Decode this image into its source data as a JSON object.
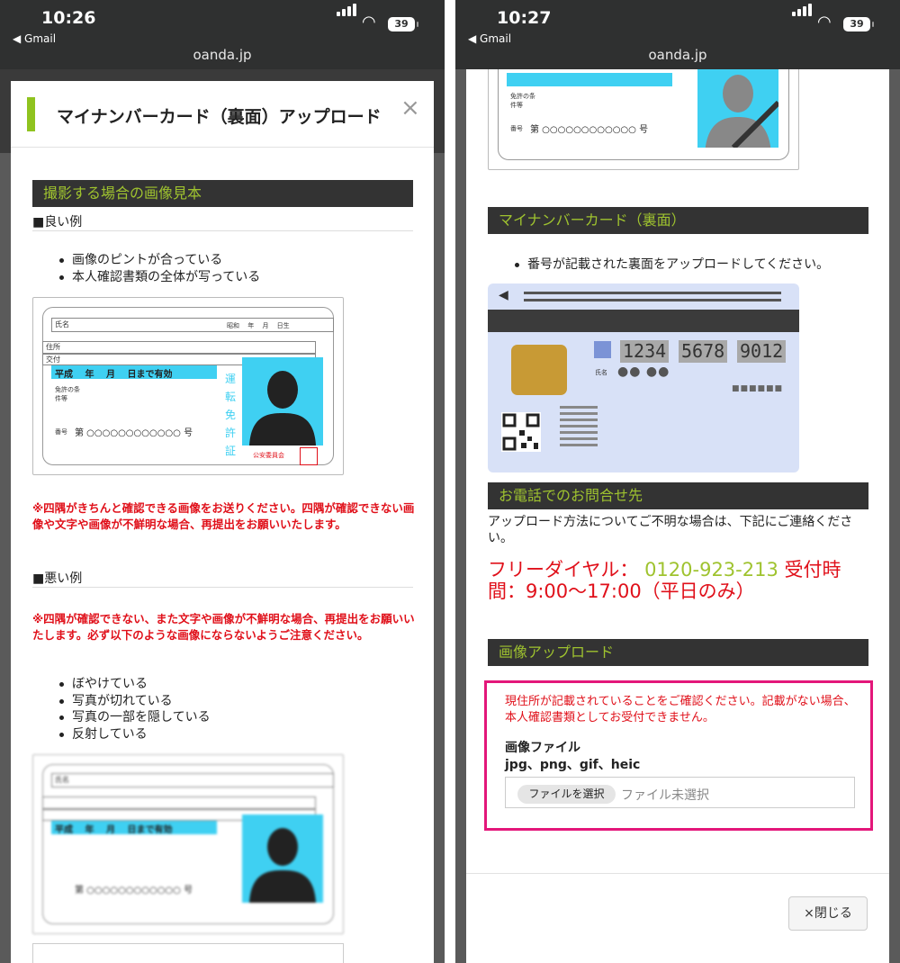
{
  "left": {
    "status": {
      "time": "10:26",
      "back_app": "◀ Gmail",
      "url": "oanda.jp",
      "battery": "39"
    },
    "modal": {
      "title": "マイナンバーカード（裏面）アップロード",
      "close_glyph": "×",
      "section_title": "撮影する場合の画像見本",
      "good_heading": "■良い例",
      "good_points": [
        "画像のピントが合っている",
        "本人確認書類の全体が写っている"
      ],
      "warning_1": "※四隅がきちんと確認できる画像をお送りください。四隅が確認できない画像や文字や画像が不鮮明な場合、再提出をお願いいたします。",
      "bad_heading": "■悪い例",
      "warning_2": "※四隅が確認できない、また文字や画像が不鮮明な場合、再提出をお願いいたします。必ず以下のような画像にならないようご注意ください。",
      "bad_points": [
        "ぼやけている",
        "写真が切れている",
        "写真の一部を隠している",
        "反射している"
      ]
    },
    "license": {
      "name_label": "氏名",
      "date_label": "昭和　 年　 月　 日生",
      "address_label": "住所",
      "issue_label": "交付",
      "valid_label": "平成　 年　 月　 日まで有効",
      "conditions_label": "免許の条件等",
      "number_label": "番号",
      "number_value": "第 ○○○○○○○○○○○○ 号",
      "vertical": [
        "運",
        "転",
        "免",
        "許",
        "証"
      ],
      "seal_text": "○○\n公安委員会",
      "seal_box": "公安委員会"
    }
  },
  "right": {
    "status": {
      "time": "10:27",
      "back_app": "◀ Gmail",
      "url": "oanda.jp",
      "battery": "39"
    },
    "modal": {
      "card_heading": "マイナンバーカード（裏面）",
      "card_point": "番号が記載された裏面をアップロードしてください。",
      "card_numbers": [
        "1234",
        "5678",
        "9012"
      ],
      "card_name_label": "氏名",
      "card_name_dots": "●● ●●",
      "card_grey": "■■■■■■",
      "contact_heading": "お電話でのお問合せ先",
      "contact_text": "アップロード方法についてご不明な場合は、下記にご連絡ください。",
      "freedial_label": "フリーダイヤル：",
      "freedial_number": "0120-923-213",
      "hours_prefix": "受付時",
      "hours_line2": "間：9:00〜17:00（平日のみ）",
      "upload_heading": "画像アップロード",
      "upload_note": "現住所が記載されていることをご確認ください。記載がない場合、本人確認書類としてお受付できません。",
      "file_label": "画像ファイル",
      "file_types": "jpg、png、gif、heic",
      "file_button": "ファイルを選択",
      "file_status": "ファイル未選択",
      "close_button": "×閉じる"
    }
  }
}
